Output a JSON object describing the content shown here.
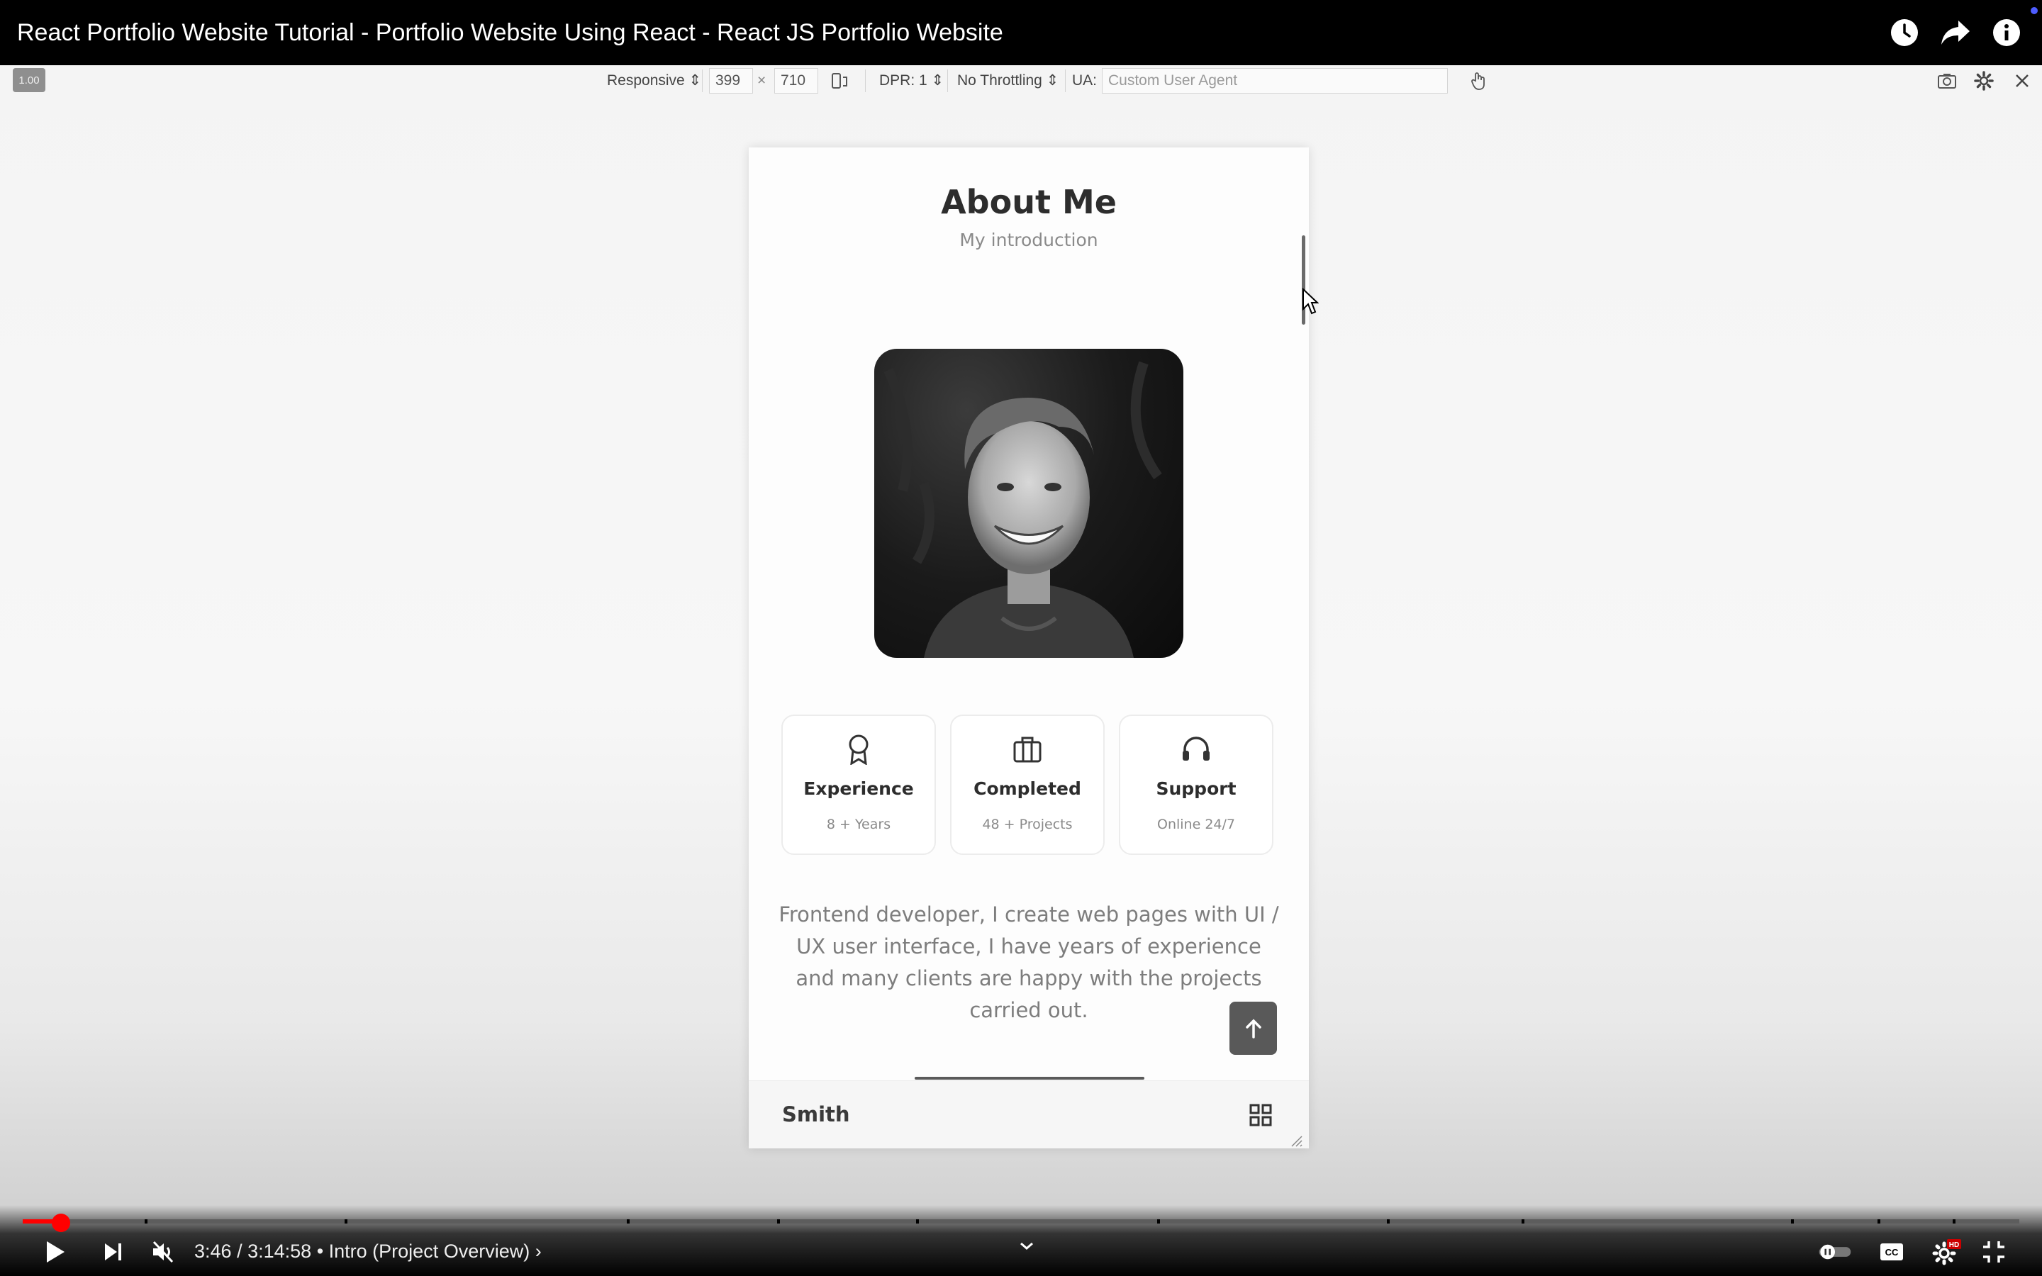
{
  "video": {
    "title": "React Portfolio Website Tutorial - Portfolio Website Using React - React JS Portfolio Website",
    "current_time": "3:46",
    "duration": "3:14:58",
    "separator": " / ",
    "chapter": "• Intro (Project Overview)",
    "chapter_chevron": "›",
    "progress_fraction": 0.0193
  },
  "devtools": {
    "zoom": "1.00",
    "device": "Responsive ⇕",
    "width": "399",
    "times": "×",
    "height": "710",
    "dpr": "DPR: 1 ⇕",
    "throttling": "No Throttling ⇕",
    "ua_label": "UA:",
    "ua_placeholder": "Custom User Agent"
  },
  "about": {
    "title": "About Me",
    "subtitle": "My introduction",
    "cards": [
      {
        "icon": "award-icon",
        "title": "Experience",
        "subtitle": "8 + Years"
      },
      {
        "icon": "briefcase-icon",
        "title": "Completed",
        "subtitle": "48 + Projects"
      },
      {
        "icon": "headset-icon",
        "title": "Support",
        "subtitle": "Online 24/7"
      }
    ],
    "description": "Frontend developer, I create web pages with UI / UX user interface, I have years of experience and many clients are happy with the projects carried out."
  },
  "footer": {
    "brand": "Smith"
  },
  "colors": {
    "progress": "#ff0000",
    "hd_badge": "#cc0000",
    "notification_dot": "#4d5cff"
  }
}
